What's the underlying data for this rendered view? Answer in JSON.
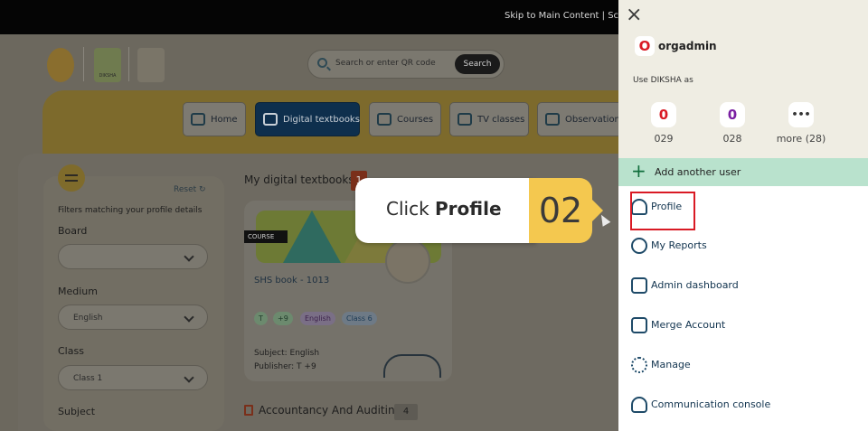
{
  "header": {
    "skip_link": "Skip to Main Content | Screen"
  },
  "search": {
    "placeholder": "Search or enter QR code",
    "button": "Search"
  },
  "logos": {
    "diksha": "DIKSHA"
  },
  "nav": {
    "items": [
      {
        "label": "Home",
        "icon": "home-icon"
      },
      {
        "label": "Digital textbooks",
        "icon": "book-icon",
        "active": true
      },
      {
        "label": "Courses",
        "icon": "graduation-cap-icon"
      },
      {
        "label": "TV classes",
        "icon": "tv-icon"
      },
      {
        "label": "Observations",
        "icon": "clipboard-icon"
      }
    ]
  },
  "filters": {
    "reset": "Reset",
    "hint": "Filters matching your profile details",
    "board": {
      "label": "Board",
      "value": ""
    },
    "medium": {
      "label": "Medium",
      "value": "English"
    },
    "class": {
      "label": "Class",
      "value": "Class 1"
    },
    "subject": {
      "label": "Subject"
    }
  },
  "section1": {
    "title": "My digital textbooks",
    "count": "1"
  },
  "card": {
    "tag": "COURSE",
    "title": "SHS book - 1013",
    "pills": [
      "T",
      "+9",
      "English",
      "Class 6"
    ],
    "subject": "Subject: English",
    "publisher": "Publisher: T +9"
  },
  "section2": {
    "title": "Accountancy And Auditing",
    "count": "4"
  },
  "callout": {
    "prefix": "Click ",
    "bold": "Profile",
    "step": "02"
  },
  "panel": {
    "close": "×",
    "user": {
      "initial": "O",
      "name": "orgadmin"
    },
    "use_as": "Use DIKSHA as",
    "users": [
      {
        "initial": "0",
        "label": "029",
        "color": "#d91a24"
      },
      {
        "initial": "0",
        "label": "028",
        "color": "#7a1fa2"
      },
      {
        "initial": "•••",
        "label": "more (28)",
        "color": "#333333"
      }
    ],
    "add_user": "Add another user",
    "menu": [
      {
        "label": "Profile",
        "icon": "user-icon"
      },
      {
        "label": "My Reports",
        "icon": "reports-icon"
      },
      {
        "label": "Admin dashboard",
        "icon": "dashboard-icon"
      },
      {
        "label": "Merge Account",
        "icon": "merge-icon"
      },
      {
        "label": "Manage",
        "icon": "gear-icon"
      },
      {
        "label": "Communication console",
        "icon": "people-icon"
      }
    ]
  },
  "colors": {
    "highlight": "#d91a24",
    "callout": "#f4c84f",
    "add_user_bg": "#b9e2cd"
  }
}
